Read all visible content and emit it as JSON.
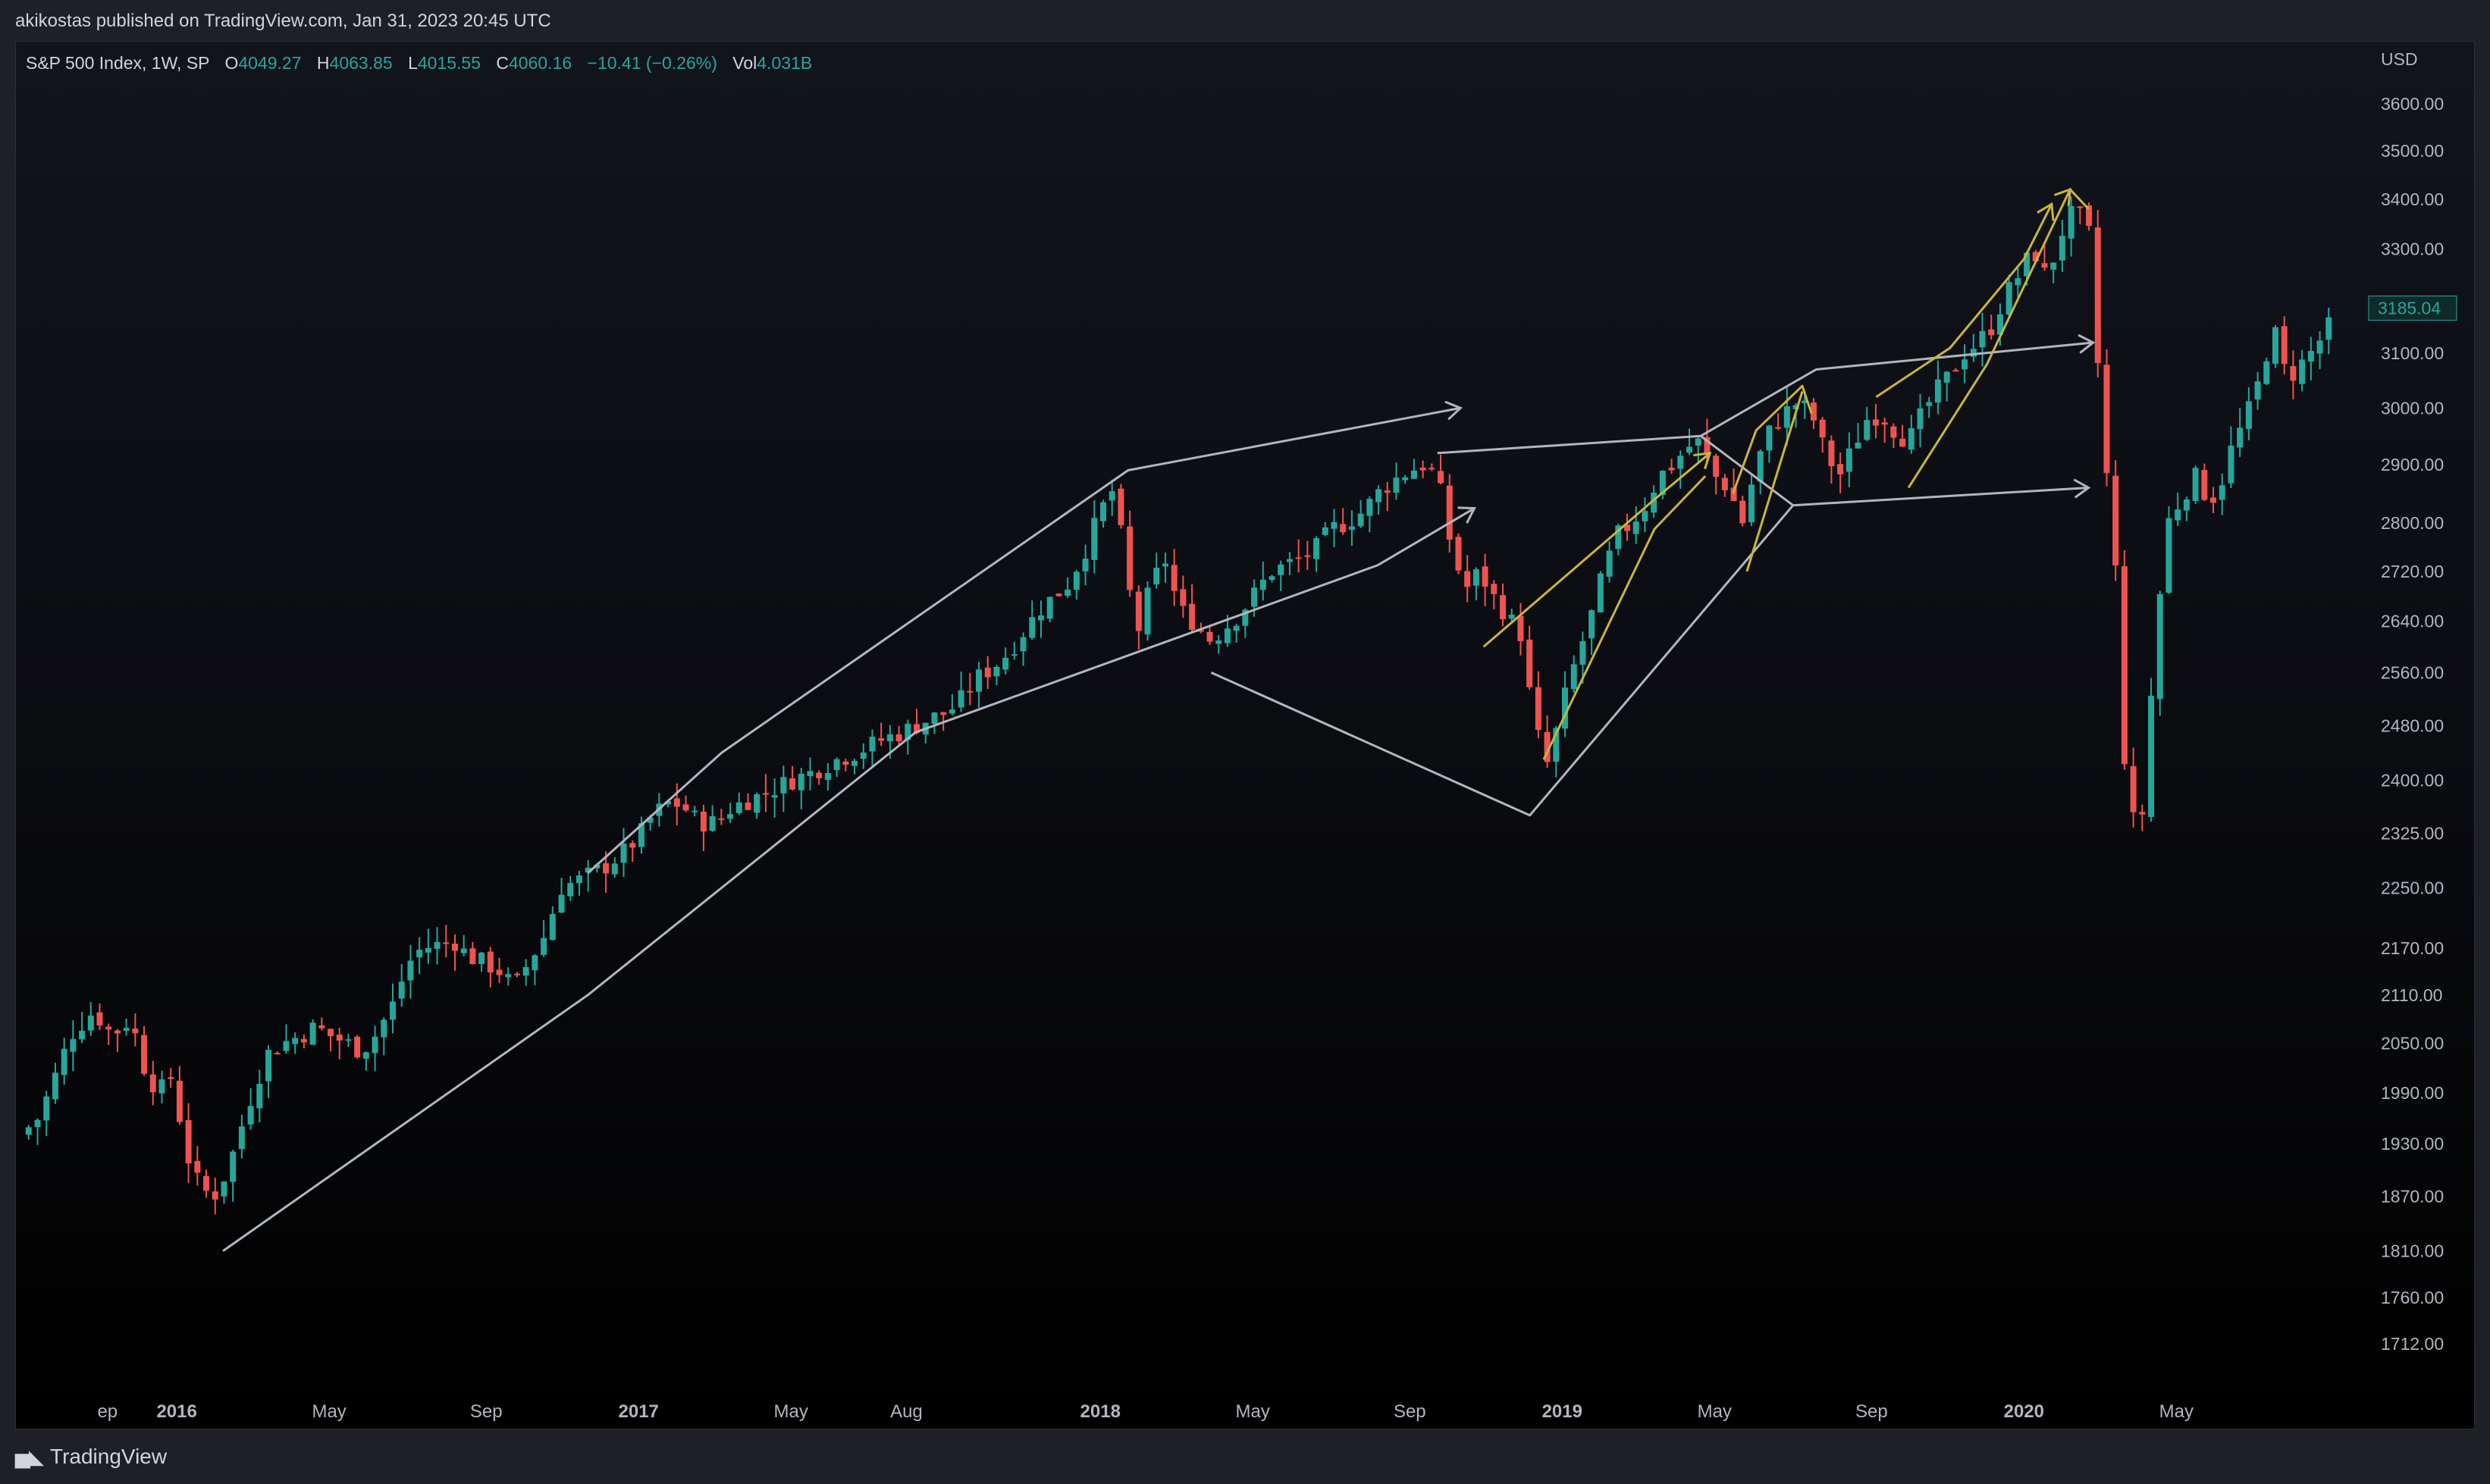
{
  "header": {
    "published": "akikostas published on TradingView.com, Jan 31, 2023 20:45 UTC"
  },
  "footer": {
    "brand": "TradingView",
    "logo_icon": "tradingview-logo-icon"
  },
  "legend": {
    "symbol": "S&P 500 Index, 1W, SP",
    "open_label": "O",
    "open": "4049.27",
    "high_label": "H",
    "high": "4063.85",
    "low_label": "L",
    "low": "4015.55",
    "close_label": "C",
    "close": "4060.16",
    "change": "−10.41 (−0.26%)",
    "vol_label": "Vol",
    "vol": "4.031B"
  },
  "colors": {
    "up": "#26a69a",
    "down": "#ef5350",
    "drawing_gray": "#b2b5be",
    "drawing_yellow": "#c9b53c",
    "axis_text": "#b2b5be"
  },
  "chart_data": {
    "type": "candlestick",
    "title": "S&P 500 Index, 1W, SP",
    "ylabel": "USD",
    "y_scale": "log",
    "ylim": [
      1650,
      3760
    ],
    "last_price_label": "3185.04",
    "y_ticks": [
      "3600.00",
      "3500.00",
      "3400.00",
      "3300.00",
      "3100.00",
      "3000.00",
      "2900.00",
      "2800.00",
      "2720.00",
      "2640.00",
      "2560.00",
      "2480.00",
      "2400.00",
      "2325.00",
      "2250.00",
      "2170.00",
      "2110.00",
      "2050.00",
      "1990.00",
      "1930.00",
      "1870.00",
      "1810.00",
      "1760.00",
      "1712.00"
    ],
    "y_tick_values": [
      3600,
      3500,
      3400,
      3300,
      3100,
      3000,
      2900,
      2800,
      2720,
      2640,
      2560,
      2480,
      2400,
      2325,
      2250,
      2170,
      2110,
      2050,
      1990,
      1930,
      1870,
      1810,
      1760,
      1712
    ],
    "x_ticks": [
      {
        "label": "ep",
        "t": -0.15,
        "bold": false
      },
      {
        "label": "2016",
        "t": 0.0,
        "bold": true
      },
      {
        "label": "May",
        "t": 0.33,
        "bold": false
      },
      {
        "label": "Sep",
        "t": 0.67,
        "bold": false
      },
      {
        "label": "2017",
        "t": 1.0,
        "bold": true
      },
      {
        "label": "May",
        "t": 1.33,
        "bold": false
      },
      {
        "label": "Aug",
        "t": 1.58,
        "bold": false
      },
      {
        "label": "2018",
        "t": 2.0,
        "bold": true
      },
      {
        "label": "May",
        "t": 2.33,
        "bold": false
      },
      {
        "label": "Sep",
        "t": 2.67,
        "bold": false
      },
      {
        "label": "2019",
        "t": 3.0,
        "bold": true
      },
      {
        "label": "May",
        "t": 3.33,
        "bold": false
      },
      {
        "label": "Sep",
        "t": 3.67,
        "bold": false
      },
      {
        "label": "2020",
        "t": 4.0,
        "bold": true
      },
      {
        "label": "May",
        "t": 4.33,
        "bold": false
      }
    ],
    "close_path": [
      [
        -0.34,
        1940
      ],
      [
        -0.3,
        1960
      ],
      [
        -0.27,
        2000
      ],
      [
        -0.23,
        2060
      ],
      [
        -0.18,
        2090
      ],
      [
        -0.14,
        2060
      ],
      [
        -0.1,
        2080
      ],
      [
        -0.07,
        2020
      ],
      [
        -0.04,
        1990
      ],
      [
        -0.01,
        2010
      ],
      [
        0.02,
        1920
      ],
      [
        0.05,
        1880
      ],
      [
        0.08,
        1870
      ],
      [
        0.11,
        1900
      ],
      [
        0.14,
        1950
      ],
      [
        0.17,
        2000
      ],
      [
        0.2,
        2040
      ],
      [
        0.23,
        2050
      ],
      [
        0.27,
        2060
      ],
      [
        0.3,
        2070
      ],
      [
        0.33,
        2060
      ],
      [
        0.37,
        2050
      ],
      [
        0.4,
        2040
      ],
      [
        0.43,
        2060
      ],
      [
        0.47,
        2100
      ],
      [
        0.5,
        2150
      ],
      [
        0.53,
        2170
      ],
      [
        0.57,
        2175
      ],
      [
        0.6,
        2180
      ],
      [
        0.63,
        2160
      ],
      [
        0.67,
        2150
      ],
      [
        0.7,
        2140
      ],
      [
        0.73,
        2120
      ],
      [
        0.77,
        2160
      ],
      [
        0.8,
        2190
      ],
      [
        0.83,
        2250
      ],
      [
        0.87,
        2260
      ],
      [
        0.9,
        2270
      ],
      [
        0.93,
        2280
      ],
      [
        0.97,
        2300
      ],
      [
        1.0,
        2320
      ],
      [
        1.03,
        2350
      ],
      [
        1.07,
        2370
      ],
      [
        1.1,
        2360
      ],
      [
        1.13,
        2340
      ],
      [
        1.17,
        2340
      ],
      [
        1.2,
        2360
      ],
      [
        1.23,
        2370
      ],
      [
        1.27,
        2380
      ],
      [
        1.3,
        2390
      ],
      [
        1.33,
        2400
      ],
      [
        1.37,
        2410
      ],
      [
        1.4,
        2420
      ],
      [
        1.43,
        2430
      ],
      [
        1.47,
        2440
      ],
      [
        1.5,
        2450
      ],
      [
        1.53,
        2460
      ],
      [
        1.57,
        2470
      ],
      [
        1.6,
        2480
      ],
      [
        1.63,
        2490
      ],
      [
        1.67,
        2500
      ],
      [
        1.7,
        2520
      ],
      [
        1.73,
        2550
      ],
      [
        1.77,
        2570
      ],
      [
        1.8,
        2590
      ],
      [
        1.83,
        2620
      ],
      [
        1.87,
        2660
      ],
      [
        1.9,
        2680
      ],
      [
        1.93,
        2700
      ],
      [
        1.97,
        2760
      ],
      [
        2.0,
        2820
      ],
      [
        2.03,
        2860
      ],
      [
        2.06,
        2700
      ],
      [
        2.08,
        2620
      ],
      [
        2.11,
        2700
      ],
      [
        2.14,
        2740
      ],
      [
        2.17,
        2660
      ],
      [
        2.2,
        2640
      ],
      [
        2.24,
        2610
      ],
      [
        2.27,
        2630
      ],
      [
        2.3,
        2650
      ],
      [
        2.33,
        2680
      ],
      [
        2.37,
        2720
      ],
      [
        2.4,
        2730
      ],
      [
        2.43,
        2740
      ],
      [
        2.47,
        2760
      ],
      [
        2.5,
        2790
      ],
      [
        2.53,
        2800
      ],
      [
        2.57,
        2820
      ],
      [
        2.6,
        2850
      ],
      [
        2.63,
        2870
      ],
      [
        2.67,
        2890
      ],
      [
        2.7,
        2900
      ],
      [
        2.73,
        2880
      ],
      [
        2.76,
        2760
      ],
      [
        2.79,
        2690
      ],
      [
        2.82,
        2720
      ],
      [
        2.85,
        2680
      ],
      [
        2.88,
        2650
      ],
      [
        2.91,
        2620
      ],
      [
        2.94,
        2480
      ],
      [
        2.97,
        2420
      ],
      [
        3.0,
        2510
      ],
      [
        3.03,
        2580
      ],
      [
        3.06,
        2640
      ],
      [
        3.09,
        2720
      ],
      [
        3.12,
        2780
      ],
      [
        3.15,
        2800
      ],
      [
        3.18,
        2830
      ],
      [
        3.21,
        2880
      ],
      [
        3.24,
        2900
      ],
      [
        3.27,
        2930
      ],
      [
        3.3,
        2940
      ],
      [
        3.33,
        2880
      ],
      [
        3.36,
        2860
      ],
      [
        3.39,
        2800
      ],
      [
        3.42,
        2900
      ],
      [
        3.45,
        2960
      ],
      [
        3.48,
        2990
      ],
      [
        3.51,
        3010
      ],
      [
        3.54,
        2990
      ],
      [
        3.57,
        2920
      ],
      [
        3.6,
        2880
      ],
      [
        3.63,
        2930
      ],
      [
        3.66,
        2980
      ],
      [
        3.69,
        2990
      ],
      [
        3.72,
        2960
      ],
      [
        3.75,
        2940
      ],
      [
        3.78,
        2990
      ],
      [
        3.81,
        3030
      ],
      [
        3.84,
        3060
      ],
      [
        3.87,
        3100
      ],
      [
        3.9,
        3120
      ],
      [
        3.93,
        3150
      ],
      [
        3.96,
        3210
      ],
      [
        3.99,
        3250
      ],
      [
        4.02,
        3300
      ],
      [
        4.05,
        3240
      ],
      [
        4.08,
        3330
      ],
      [
        4.11,
        3380
      ],
      [
        4.14,
        3340
      ],
      [
        4.17,
        2960
      ],
      [
        4.2,
        2710
      ],
      [
        4.22,
        2400
      ],
      [
        4.25,
        2300
      ],
      [
        4.27,
        2480
      ],
      [
        4.29,
        2650
      ],
      [
        4.31,
        2800
      ],
      [
        4.34,
        2840
      ],
      [
        4.37,
        2880
      ],
      [
        4.4,
        2840
      ],
      [
        4.42,
        2850
      ],
      [
        4.45,
        2930
      ],
      [
        4.48,
        2980
      ],
      [
        4.51,
        3050
      ],
      [
        4.54,
        3150
      ],
      [
        4.57,
        3050
      ],
      [
        4.6,
        3080
      ],
      [
        4.63,
        3110
      ],
      [
        4.66,
        3150
      ]
    ]
  }
}
